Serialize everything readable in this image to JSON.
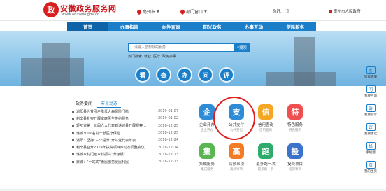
{
  "header": {
    "site_title": "安徽政务服务网",
    "site_url": "www.ahzwfw.gov.cn",
    "city": "亳州市",
    "dept": "部门窗口",
    "user_label": "你好,",
    "user_name": "[  ]",
    "org": "亳州市人民政府"
  },
  "nav": [
    "首页",
    "办事指南",
    "办件查询",
    "阳光政务",
    "办事互动",
    "便民服务"
  ],
  "search": {
    "placeholder": "请输入您想找的服务",
    "button": "搜索"
  },
  "hot": {
    "label": "热门搜索",
    "items": [
      "就业",
      "医疗",
      "政务办事"
    ]
  },
  "circles": [
    "看",
    "查",
    "办",
    "问",
    "评"
  ],
  "tabs": [
    "政务要闻",
    "市县动态"
  ],
  "news": [
    {
      "title": "涡阳县为贫困户降低大病保险门槛",
      "date": "2019-01-07"
    },
    {
      "title": "利辛县扎实开展家庭医生签约服务",
      "date": "2019-01-02"
    },
    {
      "title": "轻叩省第十三届人大代表到谯城县开展视察…",
      "date": "2018-12-25"
    },
    {
      "title": "谯城3000名村干部医疗保险",
      "date": "2018-12-25"
    },
    {
      "title": "涡阳：坚持“三个提升”开好党代会年会",
      "date": "2018-12-24"
    },
    {
      "title": "利辛县召开2019年扶贫项目库动态调整会议",
      "date": "2018-12-14"
    },
    {
      "title": "谯城乡村门渡乡村振兴“升级版”",
      "date": "2018-12-13"
    },
    {
      "title": "蒙城：“一站式”惠民服务便民利民",
      "date": "2018-12-13"
    }
  ],
  "services": [
    {
      "name": "企业开办",
      "sub": "企业开办",
      "icon": "企",
      "color": "#2e8bd6"
    },
    {
      "name": "公共支付",
      "sub": "公共支付",
      "icon": "支",
      "color": "#2e8bd6"
    },
    {
      "name": "信用查询",
      "sub": "信用查询",
      "icon": "信",
      "color": "#f5a623"
    },
    {
      "name": "特色服务",
      "sub": "特色服务",
      "icon": "特",
      "color": "#ef4f4f"
    },
    {
      "name": "集成服务",
      "sub": "集成服务",
      "icon": "集",
      "color": "#5ab552"
    },
    {
      "name": "高频事项",
      "sub": "高频事项",
      "icon": "高",
      "color": "#f47b24"
    },
    {
      "name": "最多跑一次",
      "sub": "最多跑一次",
      "icon": "跑",
      "color": "#2dab6b"
    },
    {
      "name": "投资项目",
      "sub": "投资项目",
      "icon": "投",
      "color": "#3a73c9"
    }
  ],
  "sidebar": [
    {
      "label": "智能客服",
      "icon": "客"
    },
    {
      "label": "我要咨询",
      "icon": "问"
    },
    {
      "label": "我要投诉",
      "icon": "诉"
    },
    {
      "label": "我要建议",
      "icon": "议"
    },
    {
      "label": "手机端",
      "icon": "机"
    },
    {
      "label": "我的主页",
      "icon": "页"
    }
  ]
}
